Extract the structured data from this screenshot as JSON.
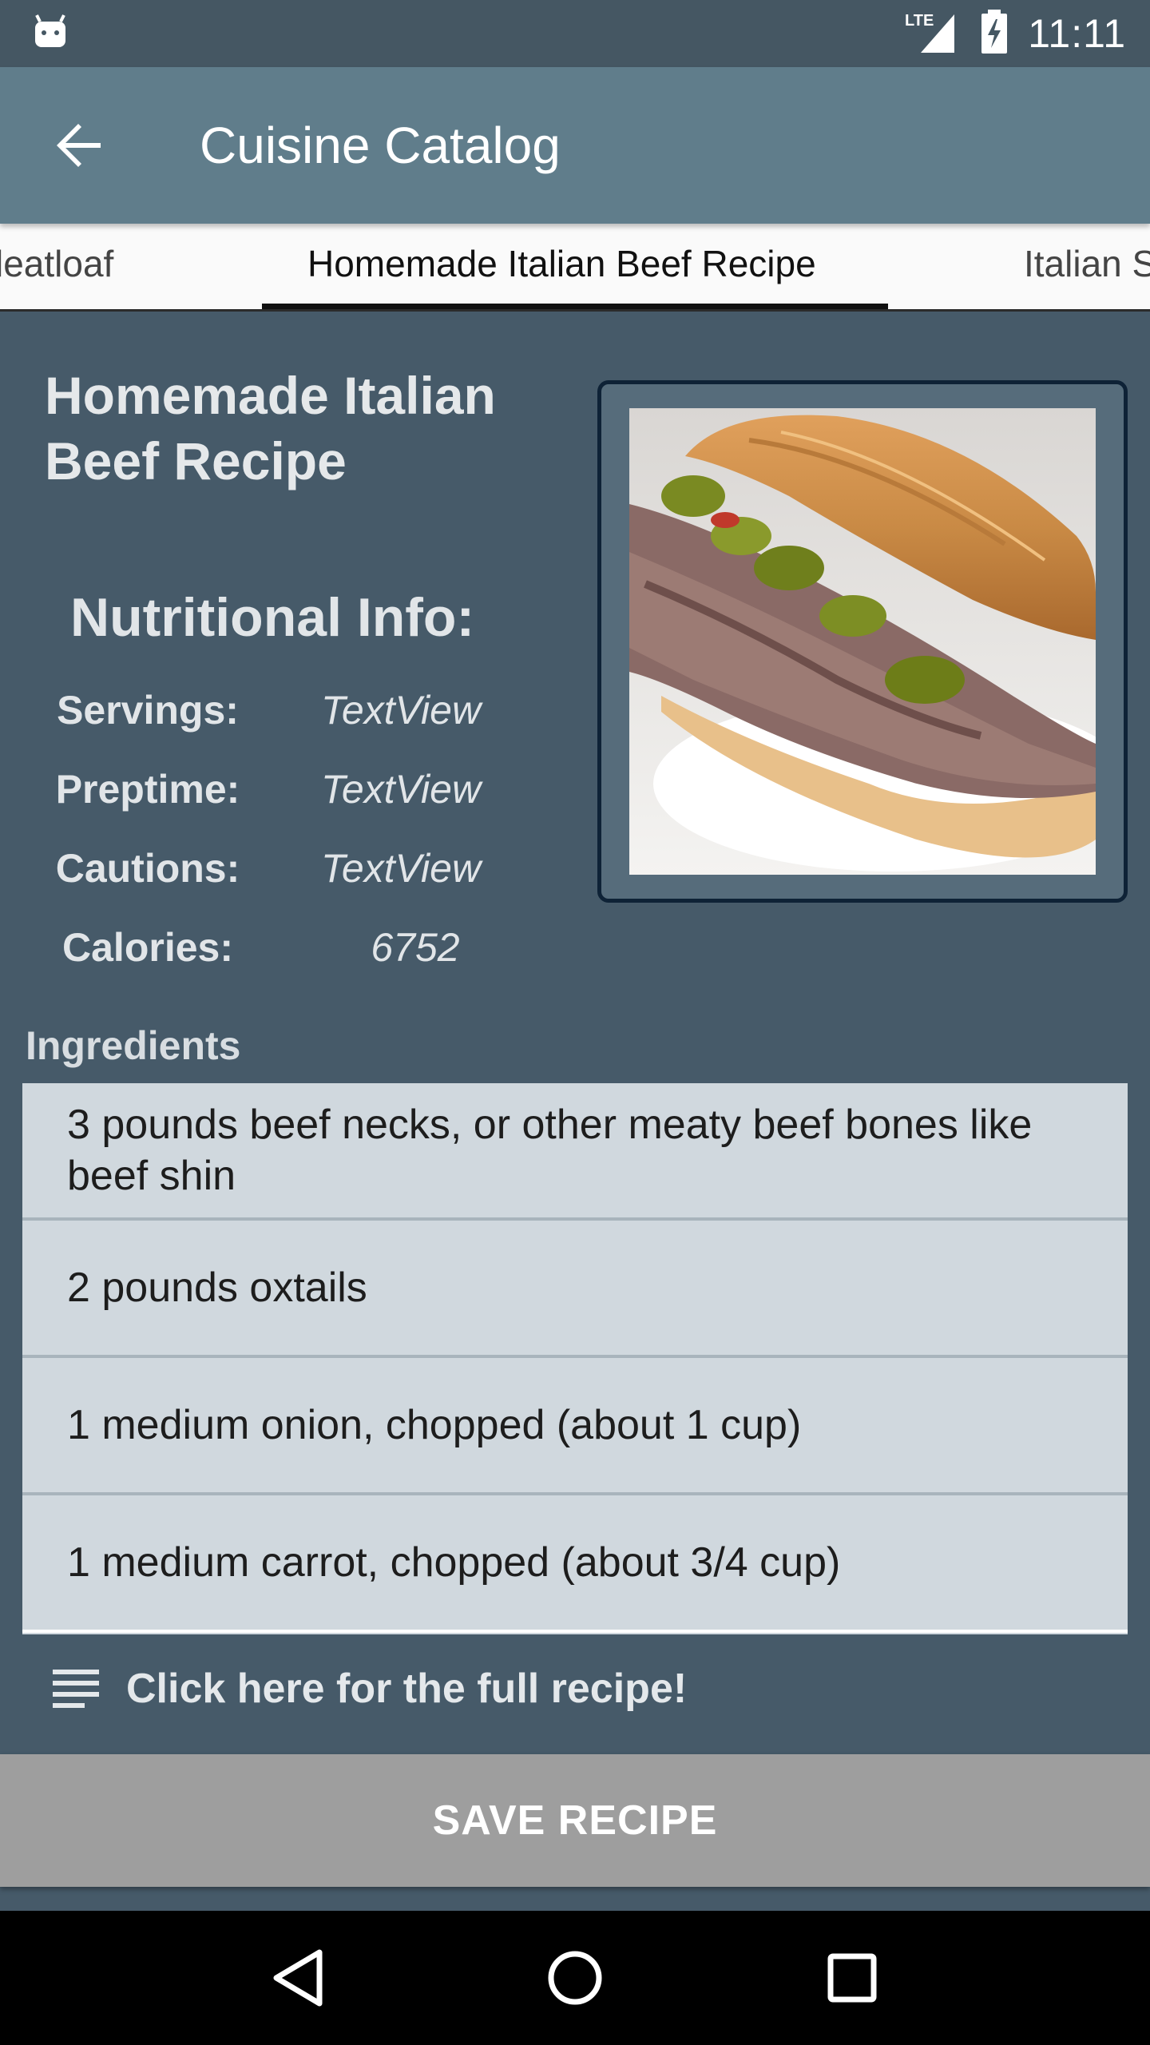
{
  "status_bar": {
    "time": "11:11",
    "network": "LTE",
    "icons": [
      "android-icon",
      "signal-icon",
      "battery-charging-icon"
    ]
  },
  "app_bar": {
    "title": "Cuisine Catalog",
    "back_icon": "arrow-back-icon"
  },
  "tabs": [
    {
      "label": "Meatloaf",
      "visible_text": "leatloaf"
    },
    {
      "label": "Homemade Italian Beef Recipe",
      "active": true
    },
    {
      "label": "Italian S",
      "visible_text": "Italian S"
    }
  ],
  "recipe": {
    "title": "Homemade Italian Beef Recipe",
    "image_alt": "Italian beef sandwich with peppers"
  },
  "nutrition": {
    "heading": "Nutritional Info:",
    "rows": [
      {
        "label": "Servings:",
        "value": "TextView"
      },
      {
        "label": "Preptime:",
        "value": "TextView"
      },
      {
        "label": "Cautions:",
        "value": "TextView"
      },
      {
        "label": "Calories:",
        "value": "6752"
      }
    ]
  },
  "ingredients": {
    "label": "Ingredients",
    "items": [
      "3 pounds beef necks, or other meaty beef bones like beef shin",
      "2 pounds oxtails",
      "1 medium onion, chopped (about 1 cup)",
      "1 medium carrot, chopped (about 3/4 cup)"
    ]
  },
  "full_recipe": {
    "text": "Click here for the full recipe!",
    "icon": "list-icon"
  },
  "save_button": {
    "label": "SAVE RECIPE"
  },
  "nav_bar": {
    "icons": [
      "back-triangle-icon",
      "home-circle-icon",
      "recents-square-icon"
    ]
  },
  "colors": {
    "status_bar": "#455763",
    "app_bar": "#607d8b",
    "background": "#465a69",
    "list_bg": "#d0d8de",
    "save_button": "#9e9e9e"
  }
}
